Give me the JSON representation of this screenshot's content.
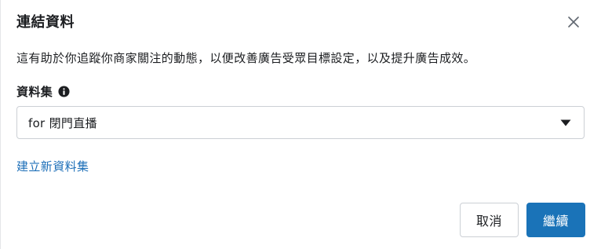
{
  "dialog": {
    "title": "連結資料",
    "description": "這有助於你追蹤你商家關注的動態，以便改善廣告受眾目標設定，以及提升廣告成效。",
    "close_icon": "close-icon"
  },
  "dataset": {
    "label": "資料集",
    "info_icon": "info-icon",
    "selected_value": "for 閉門直播",
    "caret_icon": "caret-down-icon"
  },
  "create_link": "建立新資料集",
  "buttons": {
    "cancel": "取消",
    "continue": "繼續"
  },
  "colors": {
    "accent": "#1a73b8",
    "link": "#1d6fb8",
    "text": "#1c1e21",
    "border": "#ccd0d5"
  }
}
